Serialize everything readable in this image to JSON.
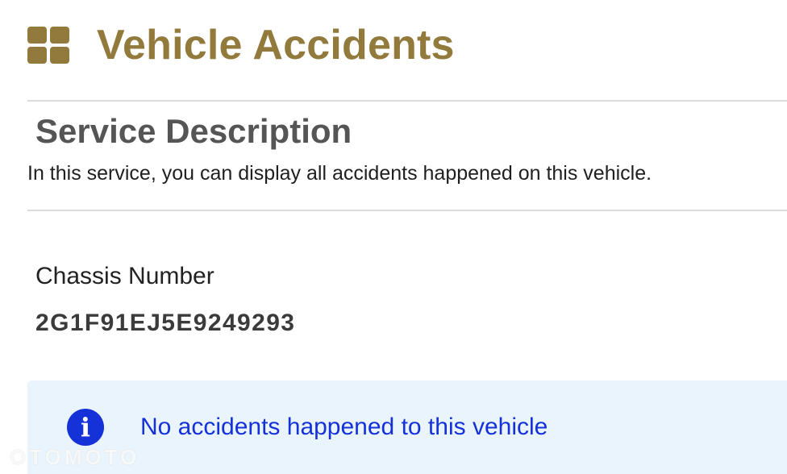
{
  "header": {
    "title": "Vehicle Accidents",
    "icon": "grid-icon",
    "color": "#927a3c"
  },
  "service": {
    "heading": "Service Description",
    "description": "In this service, you can display all accidents happened on this vehicle."
  },
  "vehicle": {
    "chassis_label": "Chassis Number",
    "chassis_value": "2G1F91EJ5E9249293"
  },
  "alert": {
    "icon": "info-icon",
    "message": "No accidents happened to this vehicle",
    "background": "#eaf4fc",
    "color": "#1532d9"
  },
  "watermark": {
    "text": "OTOMOTO"
  }
}
